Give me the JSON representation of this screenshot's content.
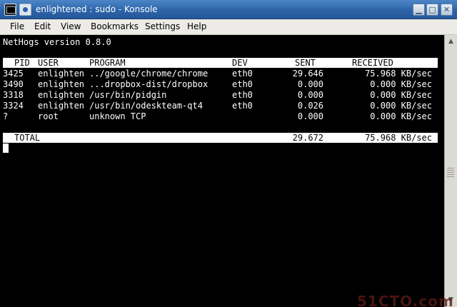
{
  "window": {
    "title": "enlightened : sudo - Konsole",
    "buttons": {
      "minimize": "▁",
      "maximize": "□",
      "close": "✕"
    }
  },
  "menubar": {
    "items": [
      "File",
      "Edit",
      "View",
      "Bookmarks",
      "Settings",
      "Help"
    ]
  },
  "terminal": {
    "version_line": "NetHogs version 0.8.0",
    "headers": {
      "pid": "PID",
      "user": "USER",
      "program": "PROGRAM",
      "dev": "DEV",
      "sent": "SENT",
      "received": "RECEIVED"
    },
    "rows": [
      {
        "pid": "3425",
        "user": "enlighten",
        "program": "../google/chrome/chrome",
        "dev": "eth0",
        "sent": "29.646",
        "received": "75.968 KB/sec"
      },
      {
        "pid": "3490",
        "user": "enlighten",
        "program": "...dropbox-dist/dropbox",
        "dev": "eth0",
        "sent": "0.000",
        "received": "0.000 KB/sec"
      },
      {
        "pid": "3318",
        "user": "enlighten",
        "program": "/usr/bin/pidgin",
        "dev": "eth0",
        "sent": "0.000",
        "received": "0.000 KB/sec"
      },
      {
        "pid": "3324",
        "user": "enlighten",
        "program": "/usr/bin/odeskteam-qt4",
        "dev": "eth0",
        "sent": "0.026",
        "received": "0.000 KB/sec"
      },
      {
        "pid": "?",
        "user": "root",
        "program": "unknown TCP",
        "dev": "",
        "sent": "0.000",
        "received": "0.000 KB/sec"
      }
    ],
    "total": {
      "label": "TOTAL",
      "sent": "29.672",
      "received": "75.968 KB/sec"
    }
  },
  "watermark": "51CTO.com"
}
